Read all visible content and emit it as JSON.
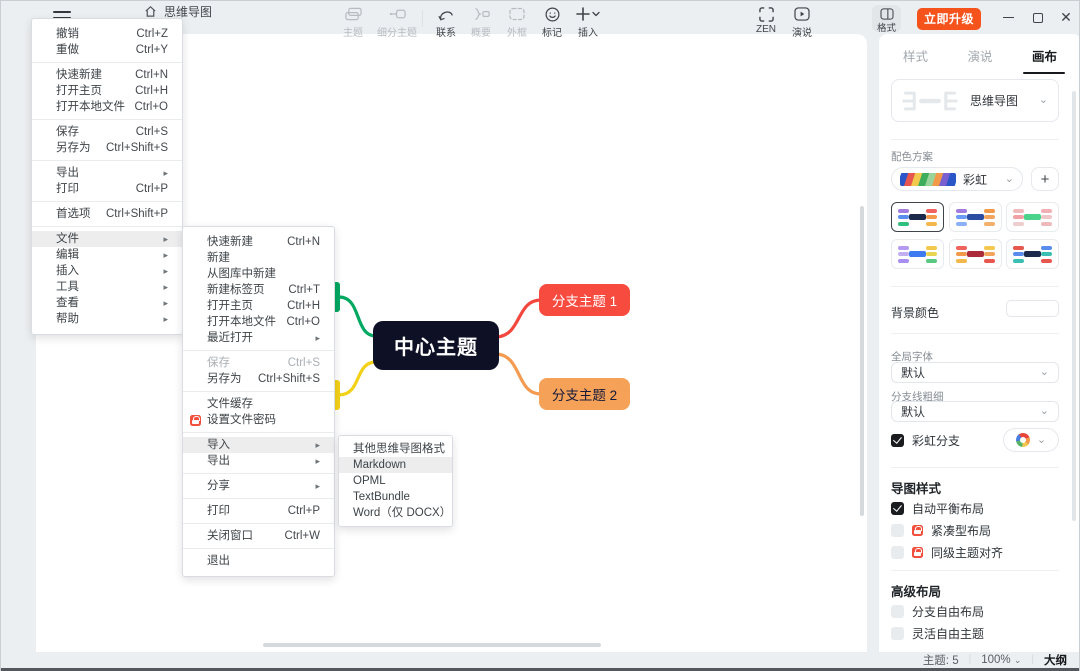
{
  "titlebar": {
    "app_title": "思维导图",
    "upgrade_label": "立即升级"
  },
  "toolbar": {
    "topic": "主题",
    "subtopic": "细分主题",
    "relation": "联系",
    "summary": "概要",
    "boundary": "外框",
    "marker": "标记",
    "insert": "插入",
    "zen": "ZEN",
    "present": "演说",
    "format": "格式"
  },
  "menus": {
    "main": {
      "items": [
        {
          "id": "undo",
          "label": "撤销",
          "shortcut": "Ctrl+Z"
        },
        {
          "id": "redo",
          "label": "重做",
          "shortcut": "Ctrl+Y"
        },
        {
          "sep": true
        },
        {
          "id": "quick-new",
          "label": "快速新建",
          "shortcut": "Ctrl+N"
        },
        {
          "id": "open-home",
          "label": "打开主页",
          "shortcut": "Ctrl+H"
        },
        {
          "id": "open-local-file",
          "label": "打开本地文件",
          "shortcut": "Ctrl+O"
        },
        {
          "sep": true
        },
        {
          "id": "save",
          "label": "保存",
          "shortcut": "Ctrl+S"
        },
        {
          "id": "save-as",
          "label": "另存为",
          "shortcut": "Ctrl+Shift+S"
        },
        {
          "sep": true
        },
        {
          "id": "export",
          "label": "导出",
          "arrow": true
        },
        {
          "id": "print",
          "label": "打印",
          "shortcut": "Ctrl+P"
        },
        {
          "sep": true
        },
        {
          "id": "preferences",
          "label": "首选项",
          "shortcut": "Ctrl+Shift+P"
        },
        {
          "sep": true
        },
        {
          "id": "file",
          "label": "文件",
          "arrow": true,
          "active": true
        },
        {
          "id": "edit",
          "label": "编辑",
          "arrow": true
        },
        {
          "id": "insert",
          "label": "插入",
          "arrow": true
        },
        {
          "id": "tools",
          "label": "工具",
          "arrow": true
        },
        {
          "id": "view",
          "label": "查看",
          "arrow": true
        },
        {
          "id": "help",
          "label": "帮助",
          "arrow": true
        }
      ]
    },
    "file_submenu": {
      "items": [
        {
          "id": "quick-new",
          "label": "快速新建",
          "shortcut": "Ctrl+N"
        },
        {
          "id": "new",
          "label": "新建"
        },
        {
          "id": "new-from-gallery",
          "label": "从图库中新建"
        },
        {
          "id": "new-tab",
          "label": "新建标签页",
          "shortcut": "Ctrl+T"
        },
        {
          "id": "open-home",
          "label": "打开主页",
          "shortcut": "Ctrl+H"
        },
        {
          "id": "open-local-file",
          "label": "打开本地文件",
          "shortcut": "Ctrl+O"
        },
        {
          "id": "recent",
          "label": "最近打开",
          "arrow": true
        },
        {
          "sep": true
        },
        {
          "id": "save",
          "label": "保存",
          "shortcut": "Ctrl+S",
          "disabled": true
        },
        {
          "id": "save-as",
          "label": "另存为",
          "shortcut": "Ctrl+Shift+S"
        },
        {
          "sep": true
        },
        {
          "id": "file-cache",
          "label": "文件缓存"
        },
        {
          "id": "set-password",
          "label": "设置文件密码",
          "locked": true
        },
        {
          "sep": true
        },
        {
          "id": "import",
          "label": "导入",
          "arrow": true,
          "active": true
        },
        {
          "id": "export",
          "label": "导出",
          "arrow": true
        },
        {
          "sep": true
        },
        {
          "id": "share",
          "label": "分享",
          "arrow": true
        },
        {
          "sep": true
        },
        {
          "id": "print",
          "label": "打印",
          "shortcut": "Ctrl+P"
        },
        {
          "sep": true
        },
        {
          "id": "close-window",
          "label": "关闭窗口",
          "shortcut": "Ctrl+W"
        },
        {
          "sep": true
        },
        {
          "id": "quit",
          "label": "退出"
        }
      ]
    },
    "import_submenu": {
      "items": [
        {
          "id": "other-mindmap-formats",
          "label": "其他思维导图格式"
        },
        {
          "id": "markdown",
          "label": "Markdown",
          "active": true
        },
        {
          "id": "opml",
          "label": "OPML"
        },
        {
          "id": "textbundle",
          "label": "TextBundle"
        },
        {
          "id": "word",
          "label": "Word（仅 DOCX）"
        }
      ]
    }
  },
  "canvas": {
    "central_topic": "中心主题",
    "branch_topic_1": "分支主题 1",
    "branch_topic_2": "分支主题 2",
    "colors": {
      "central_bg": "#0e1126",
      "branch1_bg": "#f84b40",
      "branch2_bg": "#f5a158",
      "line_red": "#f4483f",
      "line_orange": "#f59b51",
      "line_green": "#00a861",
      "line_yellow": "#f3d117"
    }
  },
  "sidebar": {
    "tabs": [
      {
        "label": "样式"
      },
      {
        "label": "演说"
      },
      {
        "label": "画布",
        "active": true
      }
    ],
    "structure_value": "思维导图",
    "color_scheme_label": "配色方案",
    "color_scheme_value": "彩虹",
    "swatch_colors": [
      "#2a56c8",
      "#e8574d",
      "#f2c94c",
      "#3fae5c",
      "#9bd49b",
      "#f2994a",
      "#7a5fd0",
      "#2a56c8"
    ],
    "schemes": [
      {
        "center": "#1b2a4a",
        "left": [
          "#a07ce0",
          "#5a8cf0",
          "#2fbf7f"
        ],
        "right": [
          "#f2625c",
          "#f2994a",
          "#f2b84c"
        ],
        "selected": true
      },
      {
        "center": "#2b4ea2",
        "left": [
          "#a07ce0",
          "#6a9cf5",
          "#8ab1f7"
        ],
        "right": [
          "#f2994a",
          "#f2a45c",
          "#f2b06b"
        ]
      },
      {
        "center": "#4ad38a",
        "left": [
          "#f0b9bc",
          "#f2a0a4",
          "#eecdce"
        ],
        "right": [
          "#f2b0b4",
          "#f0c5c7",
          "#eeb9bb"
        ]
      },
      {
        "center": "#3e7bf2",
        "left": [
          "#b49af0",
          "#c3aef2",
          "#a88ef0"
        ],
        "right": [
          "#f2c94c",
          "#e8d44f",
          "#58c882"
        ]
      },
      {
        "center": "#ab2b3a",
        "left": [
          "#f2625c",
          "#f2994a",
          "#f2b84c"
        ],
        "right": [
          "#f2c94c",
          "#f2a45c",
          "#e8574d"
        ]
      },
      {
        "center": "#1b2a4a",
        "left": [
          "#e8574d",
          "#5a8cf0",
          "#3bbfb2"
        ],
        "right": [
          "#5a8cf0",
          "#3bbfb2",
          "#e8574d"
        ]
      }
    ],
    "background_label": "背景颜色",
    "background_value": "#ffffff",
    "global_font_label": "全局字体",
    "global_font_value": "默认",
    "branch_width_label": "分支线粗细",
    "branch_width_value": "默认",
    "rainbow_branch_label": "彩虹分支",
    "rainbow_branch_checked": true,
    "map_style_heading": "导图样式",
    "map_style_options": [
      {
        "label": "自动平衡布局",
        "checked": true
      },
      {
        "label": "紧凑型布局",
        "checked": false,
        "locked": true
      },
      {
        "label": "同级主题对齐",
        "checked": false,
        "locked": true
      }
    ],
    "advanced_heading": "高级布局",
    "advanced_options": [
      {
        "label": "分支自由布局",
        "checked": false
      },
      {
        "label": "灵活自由主题",
        "checked": false
      }
    ]
  },
  "statusbar": {
    "topic_count": "主题: 5",
    "zoom": "100%",
    "outline": "大纲"
  }
}
